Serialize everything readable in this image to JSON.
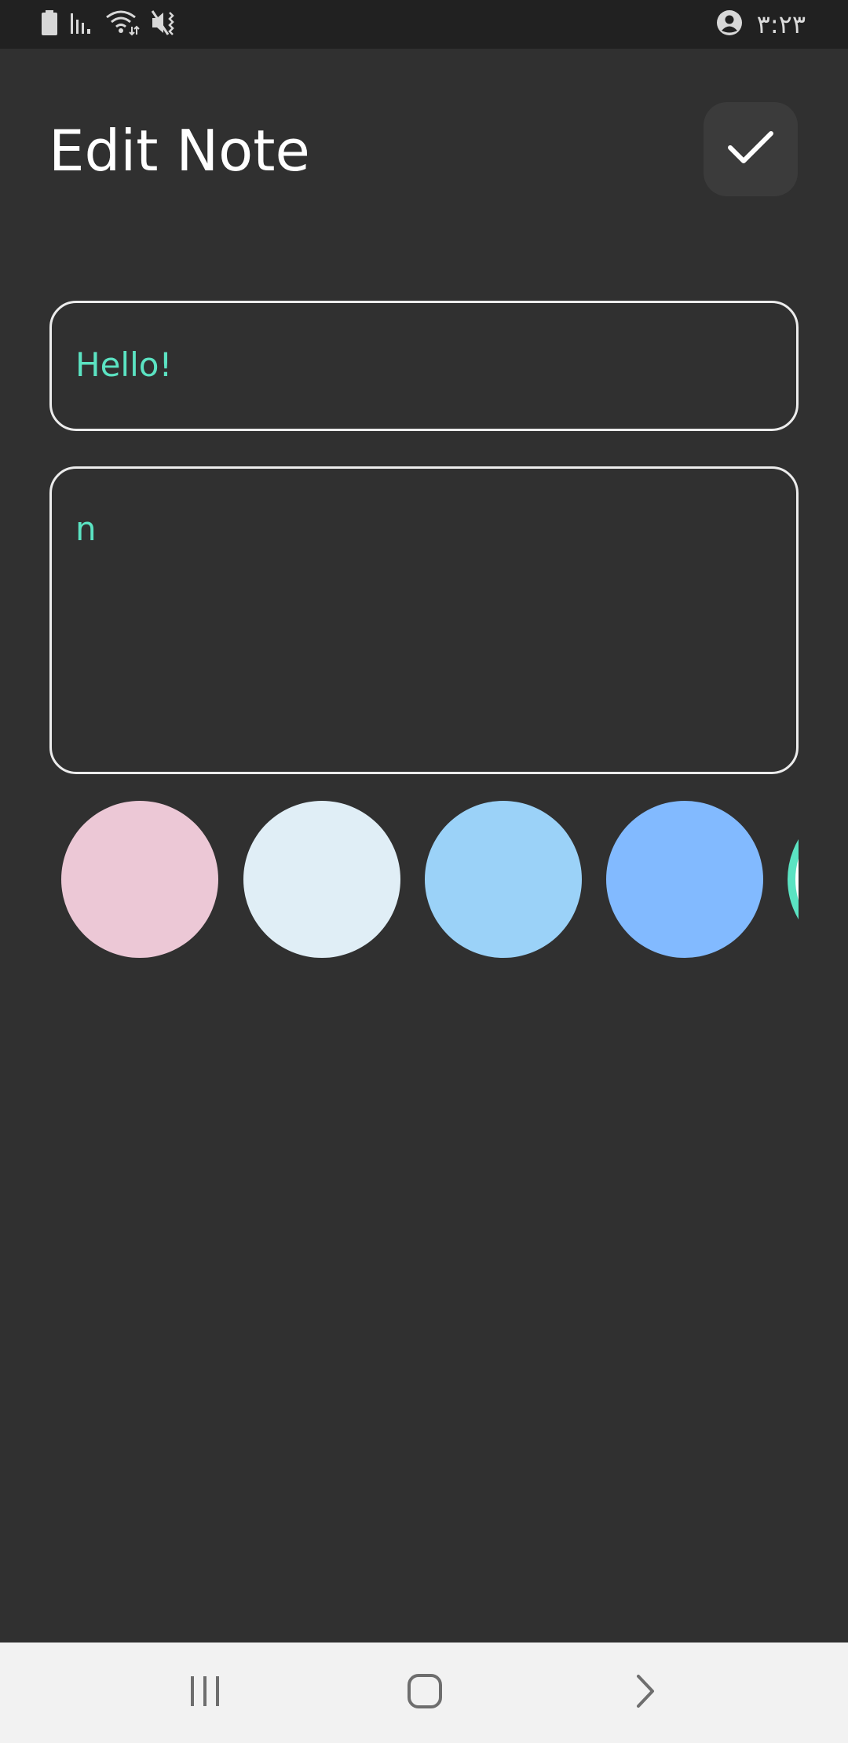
{
  "status_bar": {
    "time": "٣:٢٣",
    "icons": [
      "battery-icon",
      "signal-icon",
      "wifi-icon",
      "mute-vibrate-icon",
      "account-icon"
    ]
  },
  "header": {
    "title": "Edit Note",
    "save_icon": "check-icon"
  },
  "form": {
    "title_value": "Hello!",
    "content_value": "n"
  },
  "palette": {
    "colors": [
      "#ecc8d6",
      "#e0eef6",
      "#9bd2f8",
      "#82baff",
      "#ffffff"
    ]
  },
  "nav_bar": {
    "icons": [
      "recent-apps-icon",
      "home-icon",
      "back-icon"
    ]
  },
  "colors": {
    "background": "#303030",
    "accent_text": "#5be3c2",
    "border": "#ececec"
  }
}
